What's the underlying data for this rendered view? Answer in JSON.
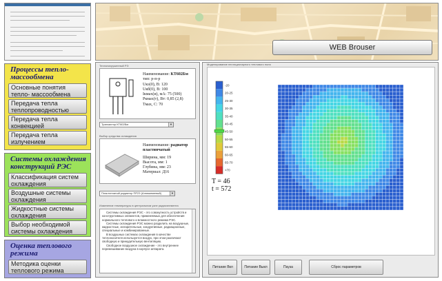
{
  "web_browser_label": "WEB Brouser",
  "sidebar": {
    "sections": [
      {
        "title": "Процессы тепло-массообмена",
        "bg": "#f3e44a",
        "items": [
          {
            "label": "Основные понятия тепло- массообмена"
          },
          {
            "label": "Передача тепла теплопроводностью"
          },
          {
            "label": "Передача тепла конвекцией"
          },
          {
            "label": "Передача тепла излучением"
          }
        ]
      },
      {
        "title": "Системы охлаждения конструкций РЭС",
        "bg": "#9ce25a",
        "items": [
          {
            "label": "Классификация систем охлаждения"
          },
          {
            "label": "Воздушные системы охлаждения"
          },
          {
            "label": "Жидкостные системы охлаждения"
          },
          {
            "label": "Выбор необходимой системы охлаждения"
          }
        ]
      },
      {
        "title": "Оценка теплового режима",
        "bg": "#a6a6e2",
        "items": [
          {
            "label": "Методика оценки теплового режима"
          }
        ]
      }
    ]
  },
  "middle": {
    "element_group_label": "Теплонагруженный РЭ",
    "transistor": {
      "name_key": "Наименование:",
      "name_val": "КТ602Бм",
      "lines": [
        "тип: р-п-р",
        "Uкэ(0), В: 120",
        "Uкб(0), В: 100",
        "Iкмах(и), мА: 75 (500)",
        "Ркмах(т), Вт: 0,85 (2,8)",
        "Тмах, С: 70"
      ]
    },
    "transistor_select": "Транзистор КТ602Бм",
    "cooling_group_label": "Выбор средства охлаждения",
    "radiator": {
      "name_key": "Наименование:",
      "name_val": "радиатор пластинчатый",
      "lines": [
        "Ширина, мм: 19",
        "Высота, мм: 1",
        "Глубина, мм: 23",
        "Материал: Д16"
      ]
    },
    "radiator_select": "Пластинчатый радиатор ПР23 (Алюминиевый)",
    "notes_group_label": "Изменение температуры в центральном узле радиоэлемента",
    "notes": [
      "Системы охлаждения РЭС - это совокупность устройств и конструктивных элементов, применяемых для обеспечения нормального теплового и влажностного режима РЭС.",
      "Системы охлаждения РЭС можно разделить на воздушные, жидкостные, испарительные, кондуктивные, радиационные, специальные и комбинированные.",
      "В воздушных системах охлаждения в качестве теплоносителя используется воздух, при этом различают свободную и принудительную вентиляцию.",
      "Свободное воздушное охлаждение - это внутреннее перемешивание воздуха в корпусе аппарата."
    ]
  },
  "simulation": {
    "title": "Моделирование нестационарного теплового поля",
    "legend_ticks": [
      "-20",
      "20-25",
      "25-30",
      "30-35",
      "35-40",
      "40-45",
      "45-50",
      "50-55",
      "55-60",
      "60-65",
      "65-70",
      ">70"
    ],
    "legend_colors": [
      "#2a5fcf",
      "#3f88e6",
      "#44b5ee",
      "#45d6e4",
      "#4fe0c0",
      "#63e08f",
      "#86e060",
      "#b8d946",
      "#e0c93a",
      "#eba03a",
      "#e6682f",
      "#d72d28"
    ],
    "temperature_readout": "T = 46",
    "time_readout": "t = 572",
    "buttons": [
      "Питание Вкл",
      "Питание Выкл",
      "Пауза",
      "Сброс параметров"
    ]
  },
  "colors": {
    "field_base": "#2f75e0",
    "grid_line": "#ffffff"
  }
}
